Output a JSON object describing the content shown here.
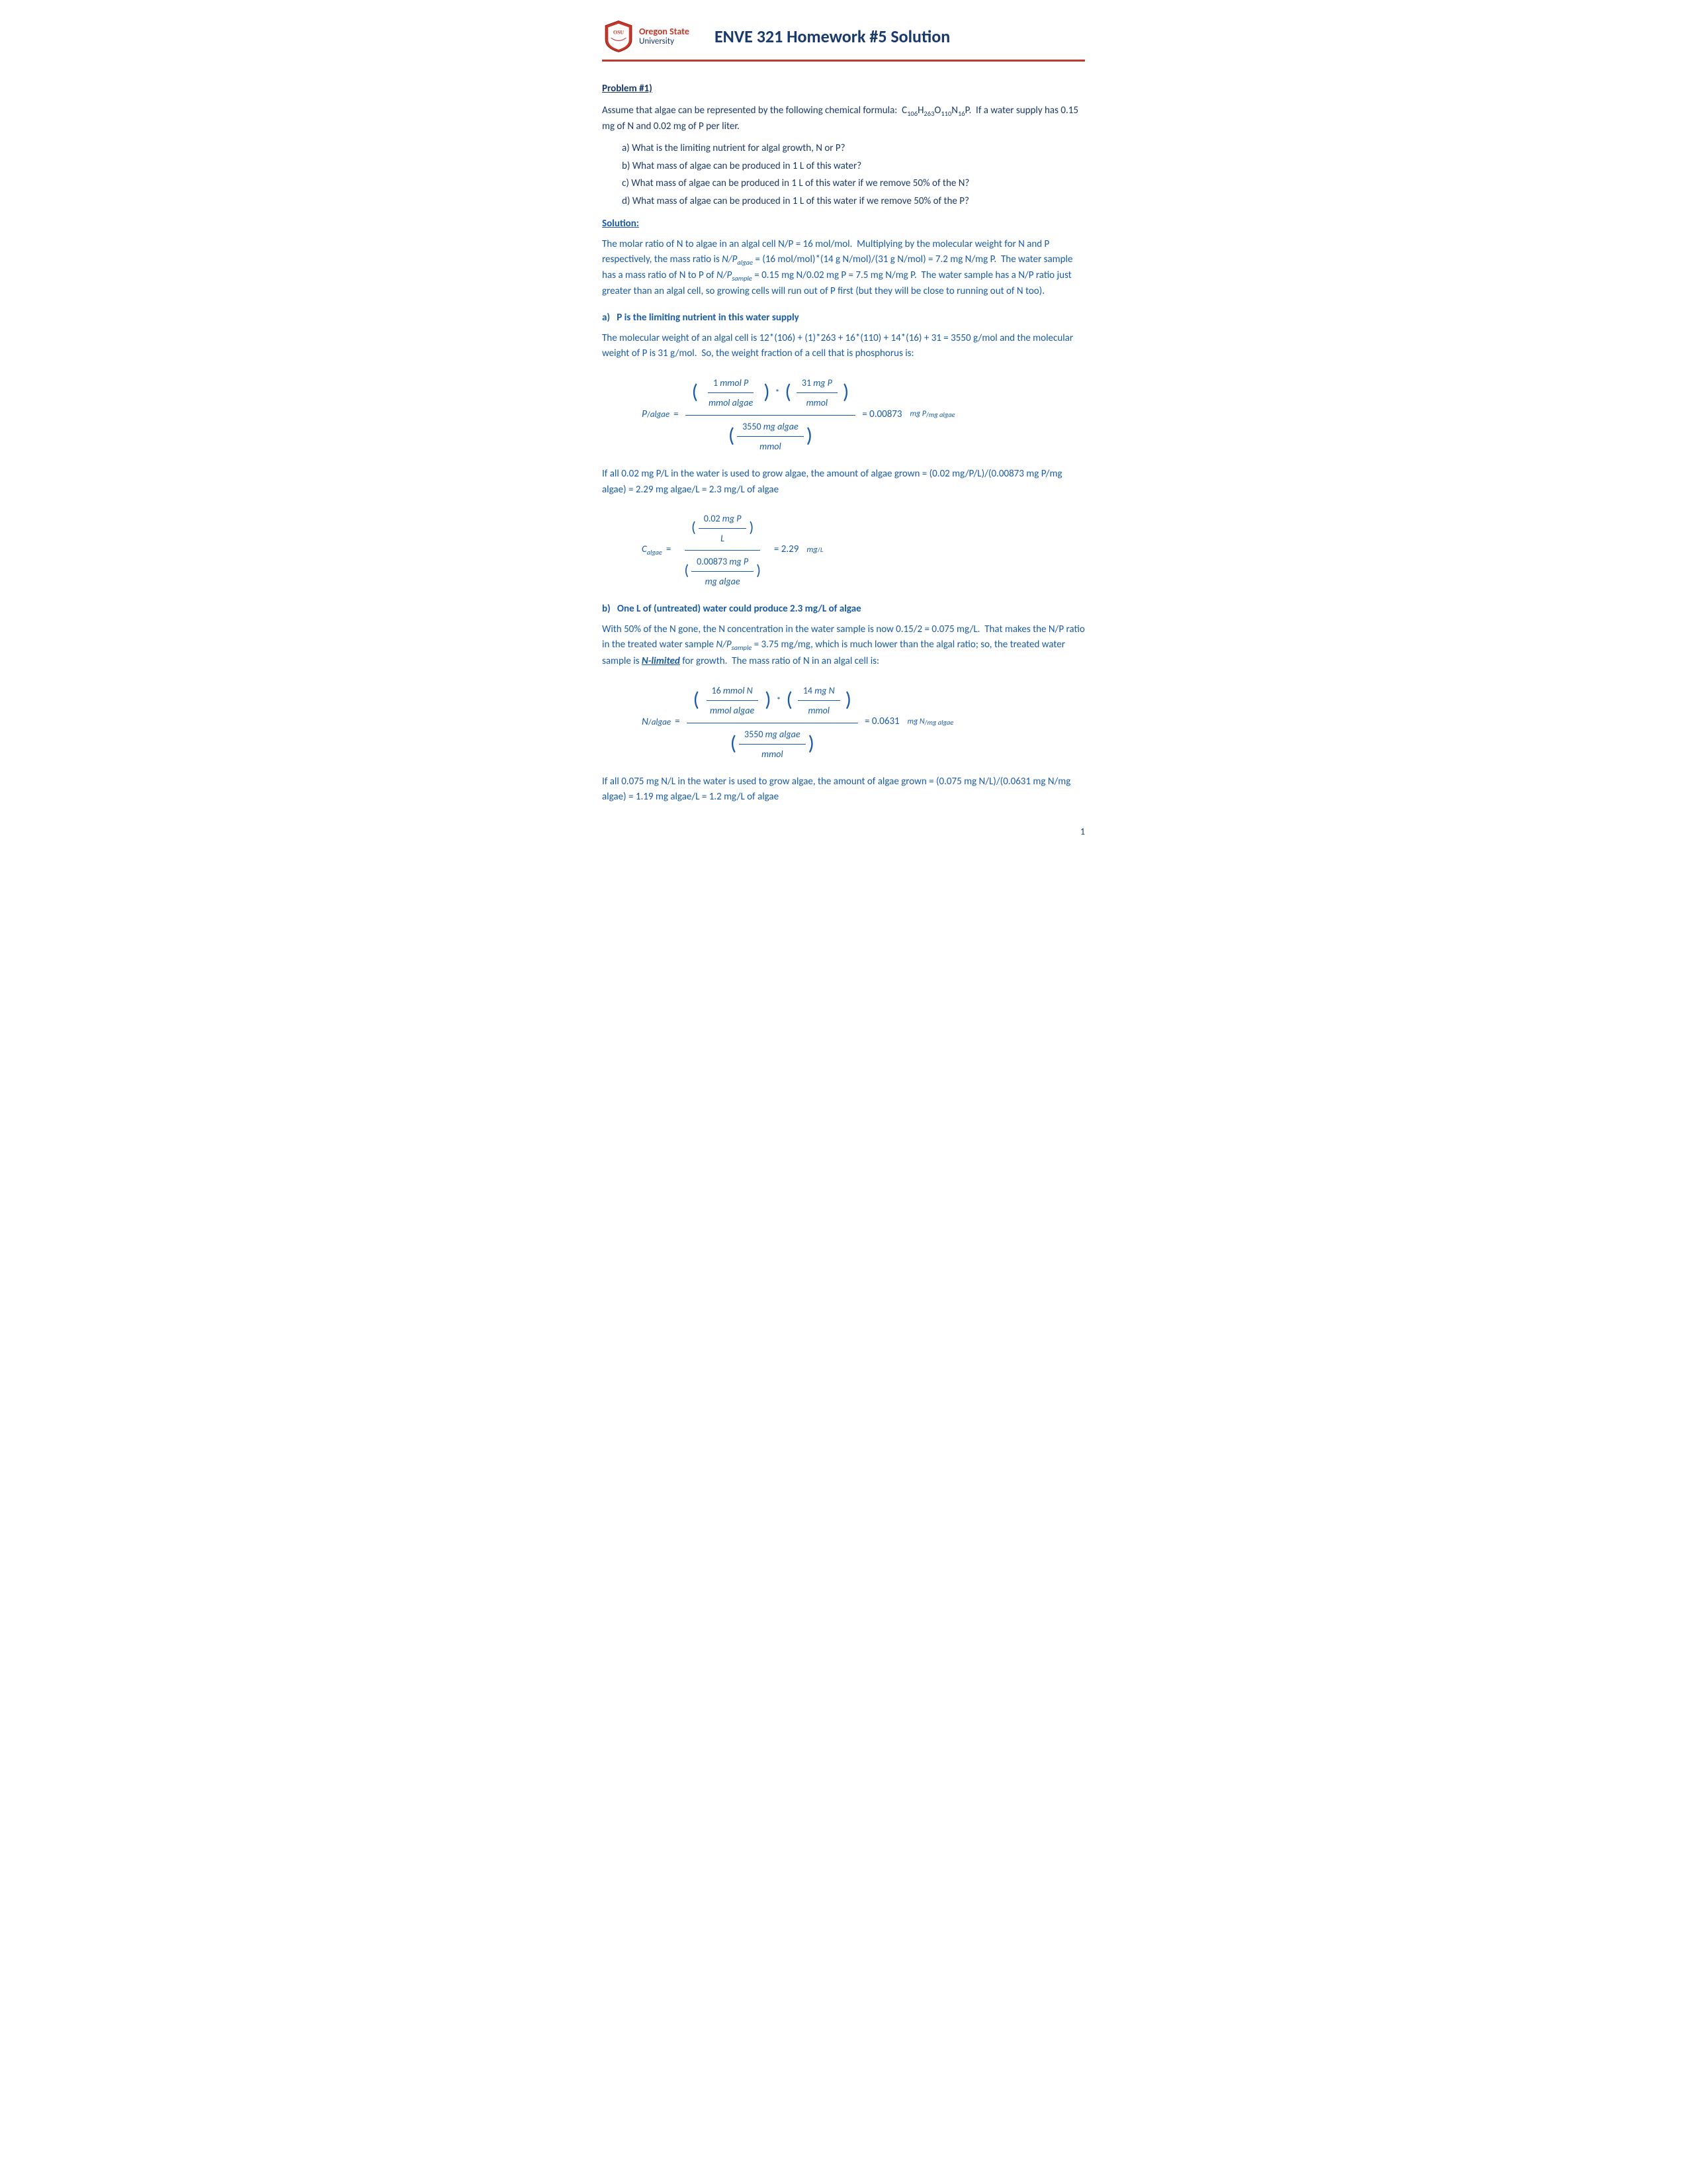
{
  "header": {
    "osu_line1": "Oregon State",
    "osu_line2": "University",
    "title": "ENVE 321 Homework #5 Solution"
  },
  "problem": {
    "label": "Problem #1)",
    "intro": "Assume that algae can be represented by the following chemical formula:  C",
    "formula_subscripts": {
      "C": "106",
      "H": "263",
      "O": "110",
      "N": "16",
      "P": ""
    },
    "intro2": ".  If a water supply has 0.15 mg of N and 0.02 mg of P per liter.",
    "parts": [
      {
        "letter": "a",
        "text": "What is the limiting nutrient for algal growth, N or P?"
      },
      {
        "letter": "b",
        "text": "What mass of algae can be produced in 1 L of this water?"
      },
      {
        "letter": "c",
        "text": "What mass of algae can be produced in 1 L of this water if we remove 50% of the N?"
      },
      {
        "letter": "d",
        "text": "What mass of algae can be produced in 1 L of this water if we remove 50% of the P?"
      }
    ]
  },
  "solution": {
    "label": "Solution:",
    "molar_ratio_text": "The molar ratio of N to algae in an algal cell N/P = 16 mol/mol.  Multiplying by the molecular weight for N and P respectively, the mass ratio is ",
    "np_algae": "N/P",
    "np_algae_sub": "algae",
    "np_calc": " = (16 mol/mol)*(14 g N/mol)/(31 g N/mol) = 7.2 mg N/mg P.  The water sample has a mass ratio of N to P of ",
    "np_sample": "N/P",
    "np_sample_sub": "sample",
    "np_calc2": " = 0.15 mg N/0.02 mg P = 7.5 mg N/mg P.  The water sample has a N/P ratio just greater than an algal cell, so growing cells will run out of P first (but they will be close to running out of N too).",
    "part_a_label": "a)   P is the limiting nutrient in this water supply",
    "part_a_text1": "The molecular weight of an algal cell is 12*(106) + (1)*263 + 16*(110) + 14*(16) + 31 = 3550 g/mol and the molecular weight of P is 31 g/mol.  So, the weight fraction of a cell that is phosphorus is:",
    "formula_p_algae_result": "= 0.00873",
    "formula_p_algae_units": "mg P",
    "formula_p_algae_units2": "mg algae",
    "part_a_text2": "If all 0.02 mg P/L in the water is used to grow algae, the amount of algae grown = (0.02 mg/P/L)/(0.00873 mg P/mg algae) = 2.29 mg algae/L = 2.3 mg/L of algae",
    "formula_c_algae_result": "= 2.29",
    "formula_c_algae_units": "mg",
    "formula_c_algae_units2": "L",
    "part_b_label": "b)   One L of (untreated) water could produce 2.3 mg/L of algae",
    "part_b_text": "With 50% of the N gone, the N concentration in the water sample is now 0.15/2 = 0.075 mg/L.  That makes the N/P ratio in the treated water sample ",
    "np_sample2": "N/P",
    "np_sample2_sub": "sample",
    "part_b_text2": " = 3.75 mg/mg, which is much lower than the algal ratio; so, the treated water sample is ",
    "n_limited": "N-limited",
    "part_b_text3": " for growth.  The mass ratio of N in an algal cell is:",
    "formula_n_algae_result": "= 0.0631",
    "formula_n_algae_units": "mg N",
    "formula_n_algae_units2": "mg algae",
    "part_b_text4": "If all 0.075 mg N/L in the water is used to grow algae, the amount of algae grown = (0.075 mg N/L)/(0.0631 mg N/mg algae) = 1.19 mg algae/L = 1.2 mg/L of algae",
    "page_number": "1"
  }
}
